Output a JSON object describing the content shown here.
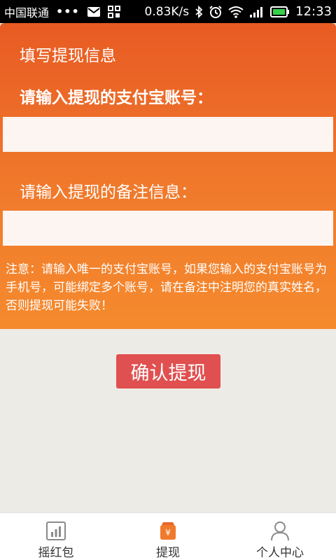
{
  "status_bar": {
    "carrier": "中国联通",
    "dots": "•••",
    "net_speed": "0.83K/s",
    "time": "12:33"
  },
  "form": {
    "title": "填写提现信息",
    "alipay_label": "请输入提现的支付宝账号：",
    "alipay_value": "",
    "remark_label": "请输入提现的备注信息：",
    "remark_value": "",
    "notice": "注意：请输入唯一的支付宝账号，如果您输入的支付宝账号为手机号，可能绑定多个账号，请在备注中注明您的真实姓名，否则提现可能失败！",
    "confirm_label": "确认提现"
  },
  "tabbar": {
    "tabs": [
      {
        "label": "摇红包",
        "icon": "chart-icon"
      },
      {
        "label": "提现",
        "icon": "wallet-yen-icon"
      },
      {
        "label": "个人中心",
        "icon": "user-icon"
      }
    ],
    "active_index": 1
  },
  "colors": {
    "header_top": "#e85b23",
    "header_bottom": "#f58a2d",
    "button": "#e05050",
    "background": "#edebe6",
    "active_icon": "#f07a2c"
  }
}
